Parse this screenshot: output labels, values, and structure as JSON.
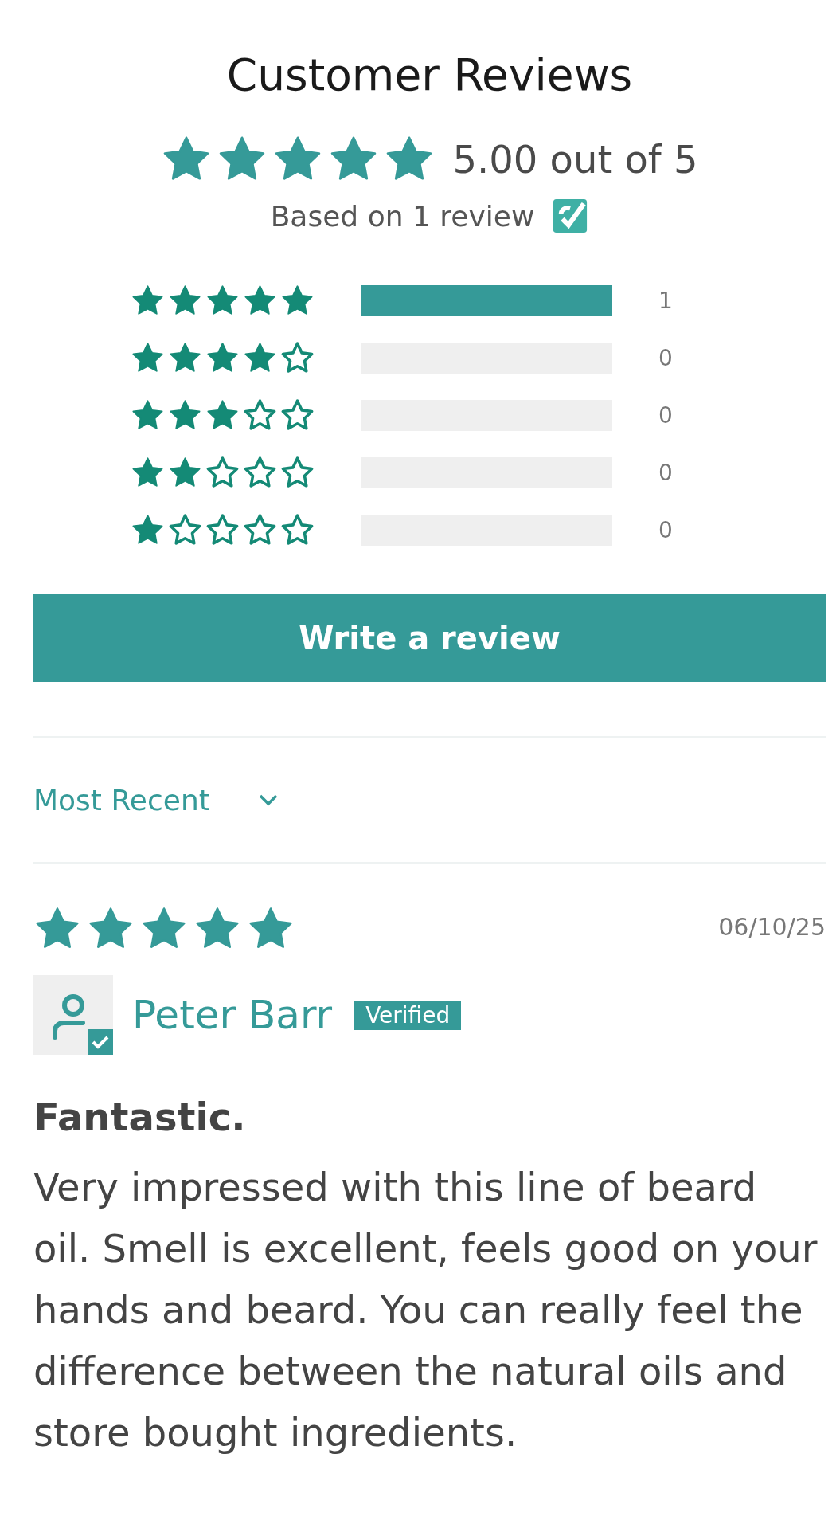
{
  "title": "Customer Reviews",
  "summary": {
    "stars": 5,
    "average": "5.00 out of 5",
    "based_on": "Based on 1 review"
  },
  "histogram": [
    {
      "stars": 5,
      "level": 1,
      "count": "1"
    },
    {
      "stars": 4,
      "level": 0,
      "count": "0"
    },
    {
      "stars": 3,
      "level": 0,
      "count": "0"
    },
    {
      "stars": 2,
      "level": 0,
      "count": "0"
    },
    {
      "stars": 1,
      "level": 0,
      "count": "0"
    }
  ],
  "write_button": "Write a review",
  "sort": {
    "value": "Most Recent"
  },
  "reviews": [
    {
      "stars": 5,
      "date": "06/10/25",
      "author": "Peter Barr",
      "verified": true,
      "badge": "Verified",
      "title": "Fantastic.",
      "body": "Very impressed with this line of beard oil. Smell is excellent, feels good on your hands and beard. You can really feel the difference between the natural oils and store bought ingredients."
    }
  ]
}
